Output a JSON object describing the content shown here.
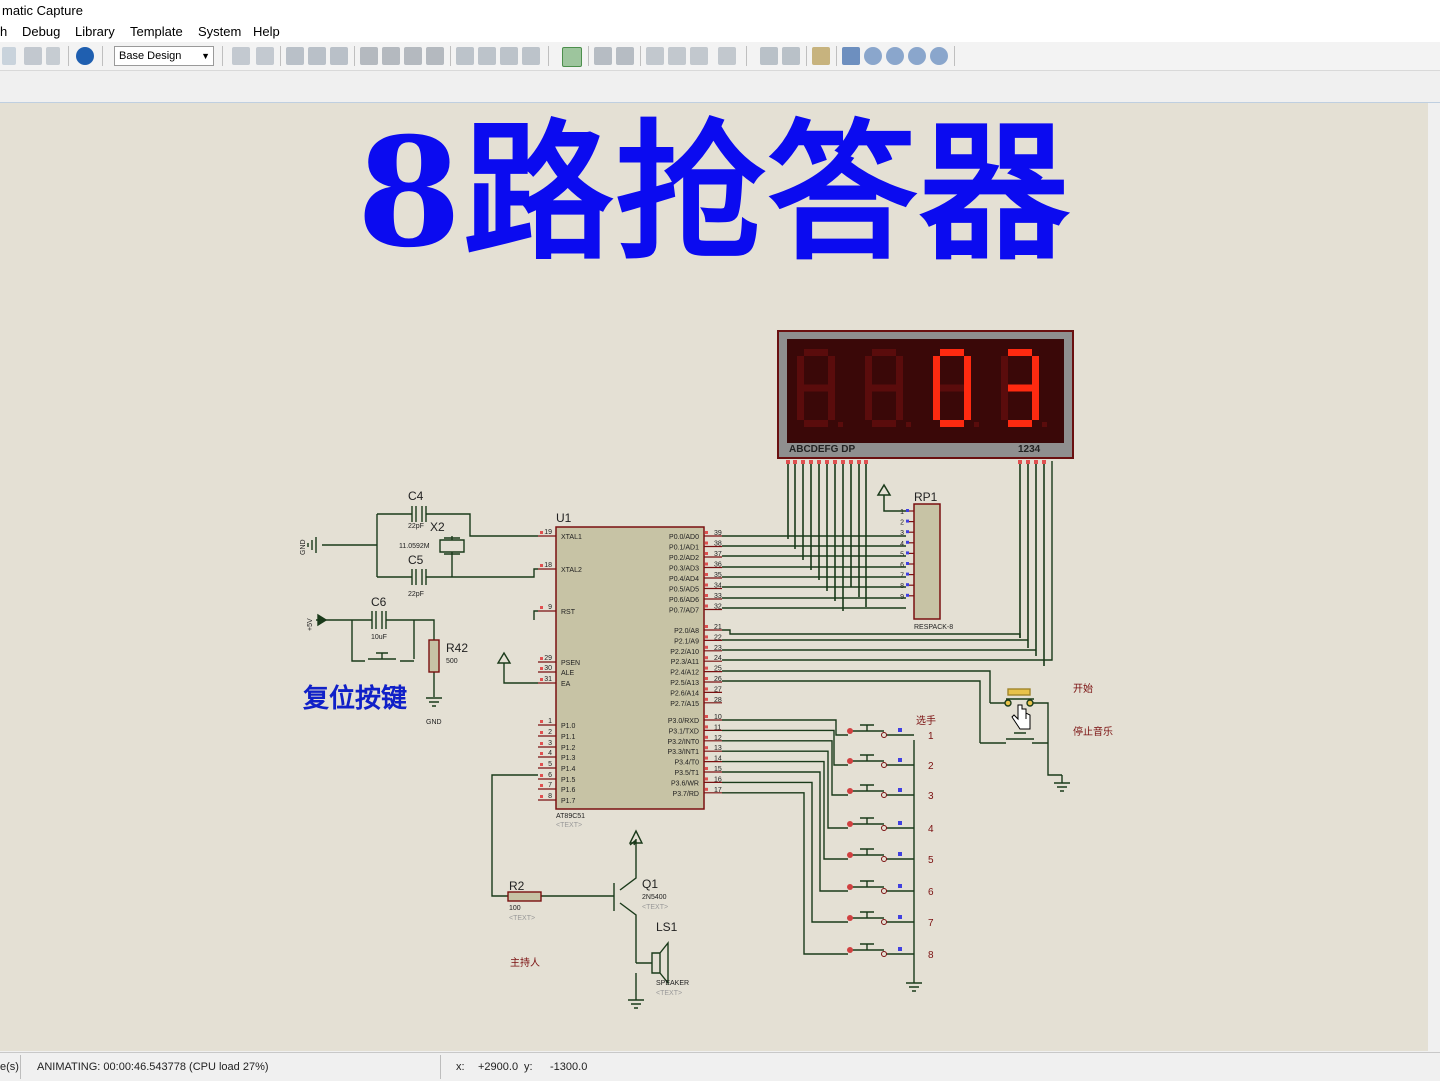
{
  "window": {
    "title": "matic Capture"
  },
  "menu": {
    "items": [
      "h",
      "Debug",
      "Library",
      "Template",
      "System",
      "Help"
    ]
  },
  "toolbar": {
    "design_combo": "Base Design"
  },
  "schematic": {
    "title": "8路抢答器",
    "reset_key_label": "复位按键",
    "display": {
      "digits": [
        "8.",
        "8.",
        "0.",
        "3."
      ],
      "pin_labels": "ABCDEFG  DP",
      "digit_labels": "1234",
      "lit_color": "#ff2a10",
      "dim_color": "#5a0c0c"
    },
    "components": {
      "c4": {
        "ref": "C4",
        "value": "22pF"
      },
      "c5": {
        "ref": "C5",
        "value": "22pF"
      },
      "x2": {
        "ref": "X2",
        "value": "11.0592M"
      },
      "c6": {
        "ref": "C6",
        "value": "10uF"
      },
      "r42": {
        "ref": "R42",
        "value": "500"
      },
      "rp1": {
        "ref": "RP1",
        "value": "RESPACK-8"
      },
      "u1": {
        "ref": "U1",
        "value": "AT89C51",
        "text": "<TEXT>"
      },
      "r2": {
        "ref": "R2",
        "value": "100",
        "text": "<TEXT>"
      },
      "q1": {
        "ref": "Q1",
        "value": "2N5400",
        "text": "<TEXT>"
      },
      "ls1": {
        "ref": "LS1",
        "value": "SPEAKER",
        "text": "<TEXT>"
      }
    },
    "power": {
      "gnd": "GND",
      "vcc": "+5V"
    },
    "u1_left_pins": [
      {
        "num": "19",
        "name": "XTAL1"
      },
      {
        "num": "18",
        "name": "XTAL2"
      },
      {
        "num": "9",
        "name": "RST"
      },
      {
        "num": "29",
        "name": "PSEN"
      },
      {
        "num": "30",
        "name": "ALE"
      },
      {
        "num": "31",
        "name": "EA"
      },
      {
        "num": "1",
        "name": "P1.0"
      },
      {
        "num": "2",
        "name": "P1.1"
      },
      {
        "num": "3",
        "name": "P1.2"
      },
      {
        "num": "4",
        "name": "P1.3"
      },
      {
        "num": "5",
        "name": "P1.4"
      },
      {
        "num": "6",
        "name": "P1.5"
      },
      {
        "num": "7",
        "name": "P1.6"
      },
      {
        "num": "8",
        "name": "P1.7"
      }
    ],
    "u1_right_pins": [
      {
        "num": "39",
        "name": "P0.0/AD0"
      },
      {
        "num": "38",
        "name": "P0.1/AD1"
      },
      {
        "num": "37",
        "name": "P0.2/AD2"
      },
      {
        "num": "36",
        "name": "P0.3/AD3"
      },
      {
        "num": "35",
        "name": "P0.4/AD4"
      },
      {
        "num": "34",
        "name": "P0.5/AD5"
      },
      {
        "num": "33",
        "name": "P0.6/AD6"
      },
      {
        "num": "32",
        "name": "P0.7/AD7"
      },
      {
        "num": "21",
        "name": "P2.0/A8"
      },
      {
        "num": "22",
        "name": "P2.1/A9"
      },
      {
        "num": "23",
        "name": "P2.2/A10"
      },
      {
        "num": "24",
        "name": "P2.3/A11"
      },
      {
        "num": "25",
        "name": "P2.4/A12"
      },
      {
        "num": "26",
        "name": "P2.5/A13"
      },
      {
        "num": "27",
        "name": "P2.6/A14"
      },
      {
        "num": "28",
        "name": "P2.7/A15"
      },
      {
        "num": "10",
        "name": "P3.0/RXD"
      },
      {
        "num": "11",
        "name": "P3.1/TXD"
      },
      {
        "num": "12",
        "name": "P3.2/INT0"
      },
      {
        "num": "13",
        "name": "P3.3/INT1"
      },
      {
        "num": "14",
        "name": "P3.4/T0"
      },
      {
        "num": "15",
        "name": "P3.5/T1"
      },
      {
        "num": "16",
        "name": "P3.6/WR"
      },
      {
        "num": "17",
        "name": "P3.7/RD"
      }
    ],
    "rp1_pins": [
      "1",
      "2",
      "3",
      "4",
      "5",
      "6",
      "7",
      "8",
      "9"
    ],
    "labels": {
      "start": "开始",
      "stop_music": "停止音乐",
      "players": "选手",
      "host": "主持人"
    },
    "player_numbers": [
      "1",
      "2",
      "3",
      "4",
      "5",
      "6",
      "7",
      "8"
    ]
  },
  "status": {
    "left_fragment": "e(s)",
    "animating": "ANIMATING: 00:00:46.543778 (CPU load 27%)",
    "x_label": "x:",
    "x_value": "+2900.0",
    "y_label": "y:",
    "y_value": "-1300.0"
  }
}
